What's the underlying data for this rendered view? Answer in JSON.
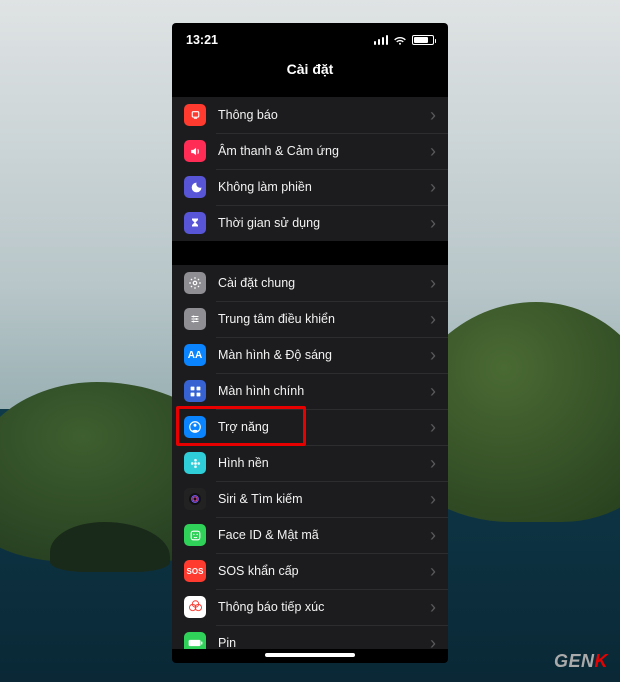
{
  "status": {
    "time": "13:21"
  },
  "header": {
    "title": "Cài đặt"
  },
  "groups": [
    {
      "rows": [
        {
          "id": "notifications",
          "label": "Thông báo",
          "icon_bg": "#ff3b30",
          "icon_glyph": "bell"
        },
        {
          "id": "sounds",
          "label": "Âm thanh & Cảm ứng",
          "icon_bg": "#ff2d55",
          "icon_glyph": "speaker"
        },
        {
          "id": "dnd",
          "label": "Không làm phiền",
          "icon_bg": "#5856d6",
          "icon_glyph": "moon"
        },
        {
          "id": "screentime",
          "label": "Thời gian sử dụng",
          "icon_bg": "#5856d6",
          "icon_glyph": "hourglass"
        }
      ]
    },
    {
      "rows": [
        {
          "id": "general",
          "label": "Cài đặt chung",
          "icon_bg": "#8e8e93",
          "icon_glyph": "gear"
        },
        {
          "id": "controlcenter",
          "label": "Trung tâm điều khiển",
          "icon_bg": "#8e8e93",
          "icon_glyph": "sliders"
        },
        {
          "id": "display",
          "label": "Màn hình & Độ sáng",
          "icon_bg": "#0a84ff",
          "icon_glyph": "aa"
        },
        {
          "id": "homescreen",
          "label": "Màn hình chính",
          "icon_bg": "#3763d2",
          "icon_glyph": "grid"
        },
        {
          "id": "accessibility",
          "label": "Trợ năng",
          "icon_bg": "#0a84ff",
          "icon_glyph": "person",
          "highlighted": true
        },
        {
          "id": "wallpaper",
          "label": "Hình nền",
          "icon_bg": "#2fcdd8",
          "icon_glyph": "flower"
        },
        {
          "id": "siri",
          "label": "Siri & Tìm kiếm",
          "icon_bg": "#222",
          "icon_glyph": "siri"
        },
        {
          "id": "faceid",
          "label": "Face ID & Mật mã",
          "icon_bg": "#30d158",
          "icon_glyph": "face"
        },
        {
          "id": "sos",
          "label": "SOS khẩn cấp",
          "icon_bg": "#ff3b30",
          "icon_glyph": "sos"
        },
        {
          "id": "exposure",
          "label": "Thông báo tiếp xúc",
          "icon_bg": "#ffffff",
          "icon_glyph": "exposure",
          "icon_fg": "#ff3b30"
        },
        {
          "id": "battery",
          "label": "Pin",
          "icon_bg": "#30d158",
          "icon_glyph": "battery"
        }
      ]
    }
  ],
  "watermark": {
    "part1": "GEN",
    "part2": "K"
  }
}
